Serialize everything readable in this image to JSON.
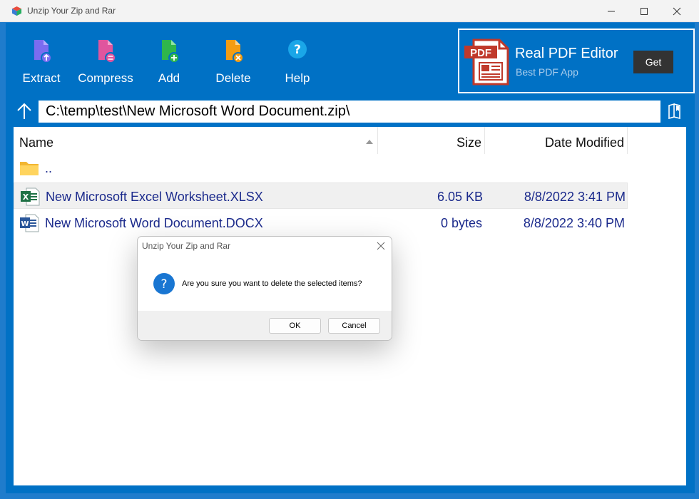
{
  "window": {
    "title": "Unzip Your Zip and Rar"
  },
  "toolbar": {
    "items": [
      {
        "label": "Extract",
        "icon": "extract-icon"
      },
      {
        "label": "Compress",
        "icon": "compress-icon"
      },
      {
        "label": "Add",
        "icon": "add-icon"
      },
      {
        "label": "Delete",
        "icon": "delete-icon"
      },
      {
        "label": "Help",
        "icon": "help-icon"
      }
    ]
  },
  "ad": {
    "logo_text": "PDF",
    "title": "Real PDF Editor",
    "subtitle": "Best PDF App",
    "button": "Get"
  },
  "address": {
    "path": "C:\\temp\\test\\New Microsoft Word Document.zip\\"
  },
  "list": {
    "columns": {
      "name": "Name",
      "size": "Size",
      "date": "Date Modified"
    },
    "rows": [
      {
        "name": "..",
        "size": "",
        "date": "",
        "icon": "folder-icon"
      },
      {
        "name": "New Microsoft Excel Worksheet.XLSX",
        "size": "6.05 KB",
        "date": "8/8/2022 3:41 PM",
        "icon": "excel-icon"
      },
      {
        "name": "New Microsoft Word Document.DOCX",
        "size": "0 bytes",
        "date": "8/8/2022 3:40 PM",
        "icon": "word-icon"
      }
    ]
  },
  "dialog": {
    "title": "Unzip Your Zip and Rar",
    "message": "Are you sure you want to delete the selected items?",
    "ok": "OK",
    "cancel": "Cancel"
  },
  "colors": {
    "frame": "#0071c5",
    "extract": "#7b6cf0",
    "compress": "#e0559e",
    "add": "#2fb64c",
    "delete": "#f39c12",
    "help": "#1aa6e8"
  }
}
